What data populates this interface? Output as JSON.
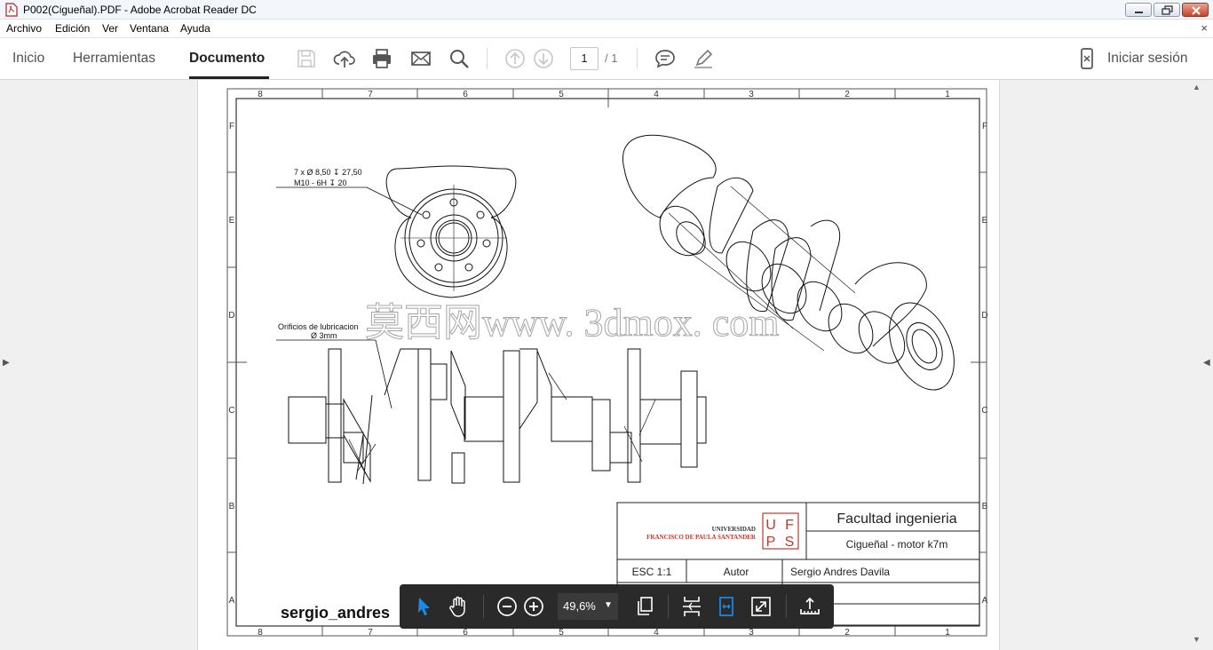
{
  "window": {
    "title": "P002(Cigueñal).PDF - Adobe Acrobat Reader DC"
  },
  "menu": {
    "items": [
      "Archivo",
      "Edición",
      "Ver",
      "Ventana",
      "Ayuda"
    ],
    "close_glyph": "×"
  },
  "toolbar": {
    "tabs": [
      "Inicio",
      "Herramientas",
      "Documento"
    ],
    "active_tab": "Documento",
    "page_current": "1",
    "page_total": "/ 1",
    "signin": "Iniciar sesión",
    "icons": [
      "save-icon",
      "upload-cloud-icon",
      "print-icon",
      "email-icon",
      "search-icon",
      "prev-page-icon",
      "next-page-icon",
      "comment-icon",
      "pen-icon",
      "mobile-icon"
    ]
  },
  "drawing": {
    "col_labels": [
      "8",
      "7",
      "6",
      "5",
      "4",
      "3",
      "2",
      "1"
    ],
    "row_labels": [
      "F",
      "E",
      "D",
      "C",
      "B",
      "A"
    ],
    "annotation_holes_1": "7 x Ø 8,50 ↧ 27,50",
    "annotation_holes_2": "M10 - 6H ↧ 20",
    "annotation_lub_1": "Orificios de lubricacion",
    "annotation_lub_2": "Ø 3mm",
    "watermark": "莫西网www. 3dmox. com",
    "author_signature": "sergio_andres",
    "title_block": {
      "university_line1": "UNIVERSIDAD",
      "university_line2": "FRANCISCO DE PAULA SANTANDER",
      "logo_letters": [
        "U",
        "F",
        "P",
        "S"
      ],
      "faculty": "Facultad ingenieria",
      "part": "Cigueñal - motor k7m",
      "scale": "ESC 1:1",
      "author_label": "Autor",
      "author_name": "Sergio Andres Davila"
    }
  },
  "floating_toolbar": {
    "zoom": "49,6%",
    "icons": [
      "select-arrow-icon",
      "hand-icon",
      "zoom-out-icon",
      "zoom-in-icon",
      "page-view-icon",
      "scroll-mode-icon",
      "fit-width-icon",
      "fullscreen-icon",
      "export-icon"
    ]
  },
  "colors": {
    "accent_blue": "#1d8ae8",
    "title_red": "#c0392b",
    "toolbar_dark": "#2a2a2a"
  }
}
